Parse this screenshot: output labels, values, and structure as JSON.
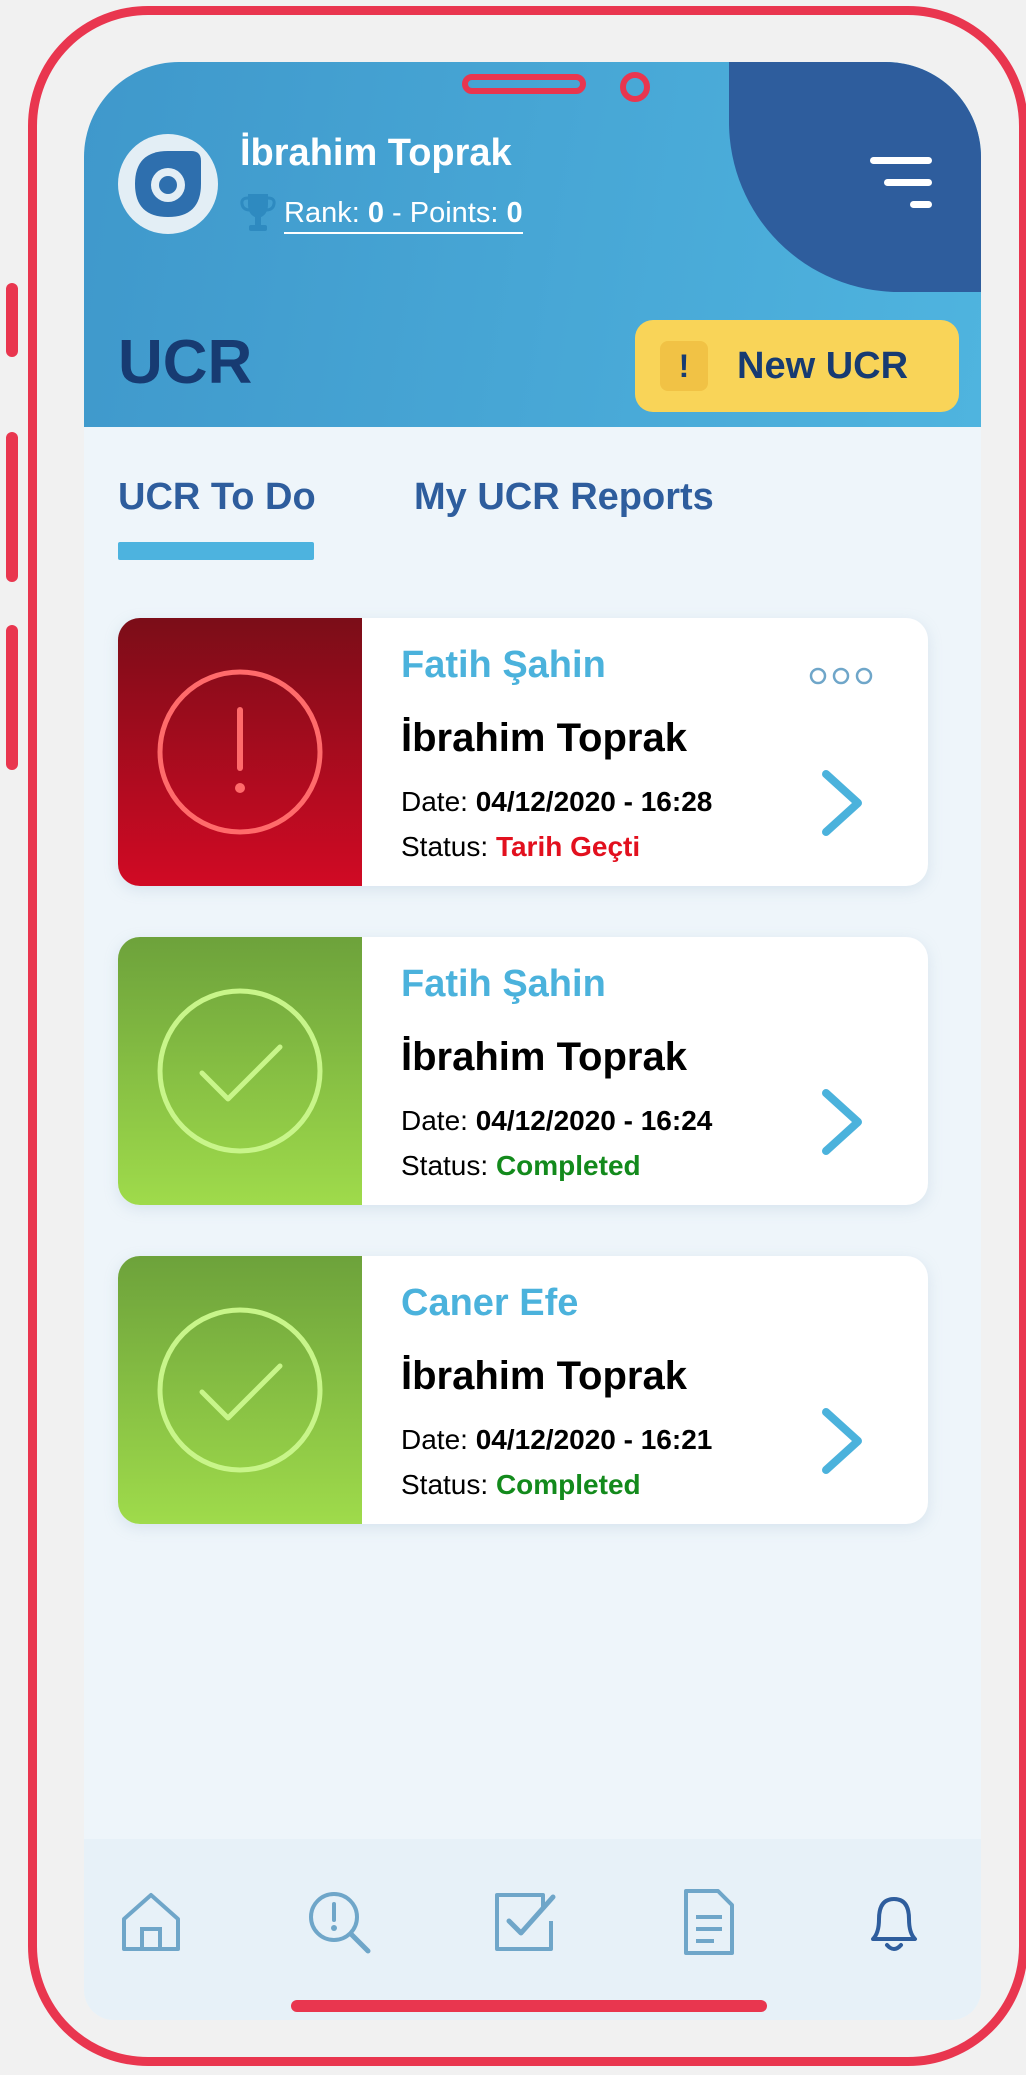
{
  "header": {
    "user_name": "İbrahim Toprak",
    "rank_label": "Rank:",
    "rank_value": "0",
    "points_label": " - Points:",
    "points_value": "0",
    "page_title": "UCR",
    "new_button_icon": "!",
    "new_button_label": "New UCR"
  },
  "tabs": [
    {
      "label": "UCR To Do",
      "active": true
    },
    {
      "label": "My UCR Reports",
      "active": false
    }
  ],
  "cards": [
    {
      "name": "Fatih Şahin",
      "user": "İbrahim Toprak",
      "date_label": "Date:",
      "date_value": "04/12/2020 - 16:28",
      "status_label": "Status:",
      "status_value": "Tarih Geçti",
      "status_color": "#e2101e",
      "icon": "alert-circle-icon",
      "has_more_menu": true
    },
    {
      "name": "Fatih Şahin",
      "user": "İbrahim Toprak",
      "date_label": "Date:",
      "date_value": "04/12/2020 - 16:24",
      "status_label": "Status:",
      "status_value": "Completed",
      "status_color": "#138a1c",
      "icon": "check-circle-icon",
      "has_more_menu": false
    },
    {
      "name": "Caner Efe",
      "user": "İbrahim Toprak",
      "date_label": "Date:",
      "date_value": "04/12/2020 - 16:21",
      "status_label": "Status:",
      "status_value": "Completed",
      "status_color": "#138a1c",
      "icon": "check-circle-icon",
      "has_more_menu": false
    }
  ],
  "bottom_nav": [
    "home-icon",
    "search-alert-icon",
    "checkbox-icon",
    "document-icon",
    "bell-icon"
  ],
  "colors": {
    "accent": "#4bb2dc",
    "brand_dark": "#173b72",
    "highlight": "#f9d458",
    "alert_red": "#d10a24",
    "ok_green": "#9fdb4b",
    "frame": "#e9364f"
  }
}
